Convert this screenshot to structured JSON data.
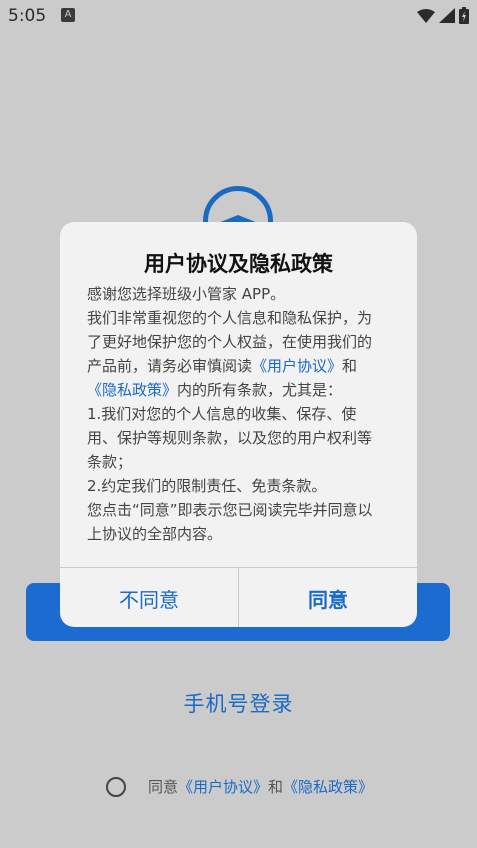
{
  "status_bar": {
    "time": "5:05",
    "notif": "A"
  },
  "background": {
    "phone_login": "手机号登录",
    "agree": {
      "prefix": "同意",
      "user_agreement": "《用户协议》",
      "and": "和",
      "privacy_policy": "《隐私政策》"
    }
  },
  "dialog": {
    "title": "用户协议及隐私政策",
    "lines": [
      "感谢您选择班级小管家 APP。",
      "我们非常重视您的个人信息和隐私保护，为",
      "了更好地保护您的个人权益，在使用我们的",
      "产品前，请务必审慎阅读",
      "《用户协议》",
      "和",
      "《隐私政策》",
      "内的所有条款，尤其是：",
      "1.我们对您的个人信息的收集、保存、使",
      "用、保护等规则条款，以及您的用户权利等",
      "条款；",
      "2.约定我们的限制责任、免责条款。",
      "您点击“同意”即表示您已阅读完毕并同意以",
      "上协议的全部内容。"
    ],
    "disagree": "不同意",
    "agree": "同意"
  },
  "colors": {
    "accent": "#1a6ac6",
    "button": "#1b6bd1",
    "scrim": "#cbcbcb"
  }
}
